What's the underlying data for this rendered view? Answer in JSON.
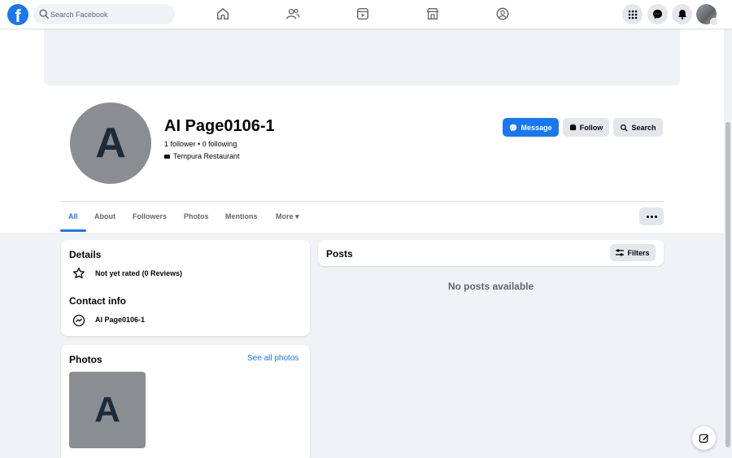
{
  "topbar": {
    "logo_letter": "f",
    "search_placeholder": "Search Facebook",
    "nav_icons": [
      "home-icon",
      "friends-icon",
      "watch-icon",
      "marketplace-icon",
      "groups-icon"
    ],
    "right_icons": [
      "menu-grid-icon",
      "messenger-icon",
      "notifications-icon"
    ]
  },
  "profile": {
    "avatar_letter": "A",
    "name": "AI Page0106-1",
    "follow_stats": "1 follower • 0 following",
    "category": "Tempura Restaurant",
    "buttons": {
      "message": "Message",
      "follow": "Follow",
      "search": "Search"
    }
  },
  "tabs": [
    {
      "label": "All",
      "active": true
    },
    {
      "label": "About",
      "active": false
    },
    {
      "label": "Followers",
      "active": false
    },
    {
      "label": "Photos",
      "active": false
    },
    {
      "label": "Mentions",
      "active": false
    },
    {
      "label": "More ▾",
      "active": false
    }
  ],
  "details": {
    "title": "Details",
    "rating": "Not yet rated (0 Reviews)",
    "contact_title": "Contact info",
    "contact_messenger": "AI Page0106-1"
  },
  "photos": {
    "title": "Photos",
    "see_all": "See all photos",
    "thumb_letter": "A"
  },
  "posts": {
    "title": "Posts",
    "filters": "Filters",
    "empty": "No posts available"
  },
  "colors": {
    "brand": "#1877f2",
    "background": "#f0f2f5",
    "button_gray": "#e4e6eb",
    "avatar_gray": "#8a8d91"
  }
}
